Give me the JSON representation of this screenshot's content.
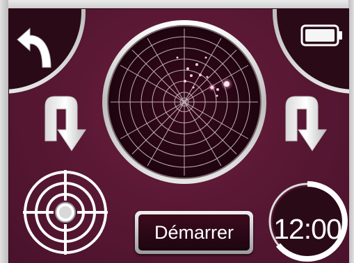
{
  "start_button": {
    "label": "Démarrer"
  },
  "timer": {
    "time": "12:00",
    "progress": 0.7
  },
  "icons": {
    "back": "back-arrow-icon",
    "battery": "battery-icon",
    "turn_left": "u-turn-down-icon",
    "turn_right": "u-turn-down-icon",
    "target": "crosshair-target-icon",
    "radar": "radar-scope"
  },
  "colors": {
    "background": "#571733",
    "panel": "#3d0b1d",
    "chrome_light": "#f1f1f1",
    "chrome_dark": "#9b9b9b",
    "text": "#ffffff"
  }
}
